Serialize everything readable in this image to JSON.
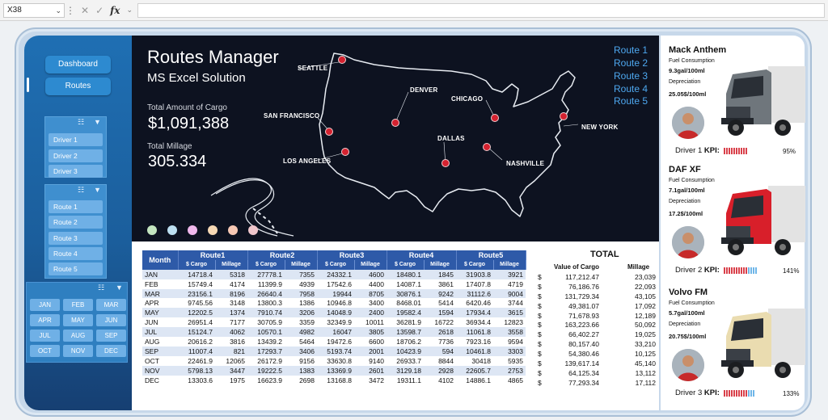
{
  "formula_bar": {
    "name_box": "X38",
    "fx_label": "fx"
  },
  "sidebar": {
    "nav": [
      {
        "label": "Dashboard"
      },
      {
        "label": "Routes"
      }
    ],
    "drivers": [
      "Driver 1",
      "Driver 2",
      "Driver 3"
    ],
    "routes": [
      "Route 1",
      "Route 2",
      "Route 3",
      "Route 4",
      "Route 5"
    ],
    "months": [
      "JAN",
      "FEB",
      "MAR",
      "APR",
      "MAY",
      "JUN",
      "JUL",
      "AUG",
      "SEP",
      "OCT",
      "NOV",
      "DEC"
    ]
  },
  "header": {
    "title": "Routes Manager",
    "subtitle": "MS Excel Solution",
    "cargo_label": "Total Amount of Cargo",
    "cargo_value": "$1,091,388",
    "millage_label": "Total Millage",
    "millage_value": "305.334"
  },
  "map": {
    "cities": [
      "SEATTLE",
      "SAN FRANCISCO",
      "LOS ANGELES",
      "DENVER",
      "CHICAGO",
      "DALLAS",
      "NASHVILLE",
      "NEW YORK"
    ],
    "legend": [
      "Route 1",
      "Route 2",
      "Route 3",
      "Route 4",
      "Route 5"
    ],
    "legend_dot_colors": [
      "#c4e6c0",
      "#bde0f2",
      "#f0b8ec",
      "#f6d8b4",
      "#f6c8b4",
      "#f0c6cc"
    ],
    "marker_color": "#d42230",
    "route_legend_color": "#4ea8f0"
  },
  "table": {
    "month_header": "Month",
    "route_headers": [
      "Route1",
      "Route2",
      "Route3",
      "Route4",
      "Route5"
    ],
    "sub_cargo": "$ Cargo",
    "sub_millage": "Millage",
    "rows": [
      {
        "m": "JAN",
        "v": [
          "14718.4",
          "5318",
          "27778.1",
          "7355",
          "24332.1",
          "4600",
          "18480.1",
          "1845",
          "31903.8",
          "3921"
        ]
      },
      {
        "m": "FEB",
        "v": [
          "15749.4",
          "4174",
          "11399.9",
          "4939",
          "17542.6",
          "4400",
          "14087.1",
          "3861",
          "17407.8",
          "4719"
        ]
      },
      {
        "m": "MAR",
        "v": [
          "23156.1",
          "8196",
          "26640.4",
          "7958",
          "19944",
          "8705",
          "30876.1",
          "9242",
          "31112.6",
          "9004"
        ]
      },
      {
        "m": "APR",
        "v": [
          "9745.56",
          "3148",
          "13800.3",
          "1386",
          "10946.8",
          "3400",
          "8468.01",
          "5414",
          "6420.46",
          "3744"
        ]
      },
      {
        "m": "MAY",
        "v": [
          "12202.5",
          "1374",
          "7910.74",
          "3206",
          "14048.9",
          "2400",
          "19582.4",
          "1594",
          "17934.4",
          "3615"
        ]
      },
      {
        "m": "JUN",
        "v": [
          "26951.4",
          "7177",
          "30705.9",
          "3359",
          "32349.9",
          "10011",
          "36281.9",
          "16722",
          "36934.4",
          "12823"
        ]
      },
      {
        "m": "JUL",
        "v": [
          "15124.7",
          "4062",
          "10570.1",
          "4982",
          "16047",
          "3805",
          "13598.7",
          "2618",
          "11061.8",
          "3558"
        ]
      },
      {
        "m": "AUG",
        "v": [
          "20616.2",
          "3816",
          "13439.2",
          "5464",
          "19472.6",
          "6600",
          "18706.2",
          "7736",
          "7923.16",
          "9594"
        ]
      },
      {
        "m": "SEP",
        "v": [
          "11007.4",
          "821",
          "17293.7",
          "3406",
          "5193.74",
          "2001",
          "10423.9",
          "594",
          "10461.8",
          "3303"
        ]
      },
      {
        "m": "OCT",
        "v": [
          "22461.9",
          "12065",
          "26172.9",
          "9156",
          "33630.8",
          "9140",
          "26933.7",
          "8844",
          "30418",
          "5935"
        ]
      },
      {
        "m": "NOV",
        "v": [
          "5798.13",
          "3447",
          "19222.5",
          "1383",
          "13369.9",
          "2601",
          "3129.18",
          "2928",
          "22605.7",
          "2753"
        ]
      },
      {
        "m": "DEC",
        "v": [
          "13303.6",
          "1975",
          "16623.9",
          "2698",
          "13168.8",
          "3472",
          "19311.1",
          "4102",
          "14886.1",
          "4865"
        ]
      }
    ]
  },
  "totals": {
    "title": "TOTAL",
    "value_header": "Value of Cargo",
    "millage_header": "Millage",
    "currency": "$",
    "rows": [
      {
        "value": "117,212.47",
        "millage": "23,039"
      },
      {
        "value": "76,186.76",
        "millage": "22,093"
      },
      {
        "value": "131,729.34",
        "millage": "43,105"
      },
      {
        "value": "49,381.07",
        "millage": "17,092"
      },
      {
        "value": "71,678.93",
        "millage": "12,189"
      },
      {
        "value": "163,223.66",
        "millage": "50,092"
      },
      {
        "value": "66,402.27",
        "millage": "19,025"
      },
      {
        "value": "80,157.40",
        "millage": "33,210"
      },
      {
        "value": "54,380.46",
        "millage": "10,125"
      },
      {
        "value": "139,617.14",
        "millage": "45,140"
      },
      {
        "value": "64,125.34",
        "millage": "13,112"
      },
      {
        "value": "77,293.34",
        "millage": "17,112"
      }
    ]
  },
  "trucks": [
    {
      "name": "Mack Anthem",
      "fuel_label": "Fuel Consumption",
      "fuel": "9.3gal/100ml",
      "dep_label": "Depreciation",
      "dep": "25.05$/100ml",
      "driver": "Driver 1",
      "kpi_label": "KPI:",
      "kpi_pct": "95%",
      "kpi_value": 0.95,
      "cab_color": "#6f767c"
    },
    {
      "name": "DAF XF",
      "fuel_label": "Fuel Consumption",
      "fuel": "7.1gal/100ml",
      "dep_label": "Depreciation",
      "dep": "17.2$/100ml",
      "driver": "Driver 2",
      "kpi_label": "KPI:",
      "kpi_pct": "141%",
      "kpi_value": 1.41,
      "cab_color": "#d81f2a"
    },
    {
      "name": "Volvo FM",
      "fuel_label": "Fuel Consumption",
      "fuel": "5.7gal/100ml",
      "dep_label": "Depreciation",
      "dep": "20.75$/100ml",
      "driver": "Driver 3",
      "kpi_label": "KPI:",
      "kpi_pct": "133%",
      "kpi_value": 1.33,
      "cab_color": "#eadcb0"
    }
  ],
  "kpi_colors": {
    "red": "#d9404a",
    "blue": "#6fb6e8"
  }
}
